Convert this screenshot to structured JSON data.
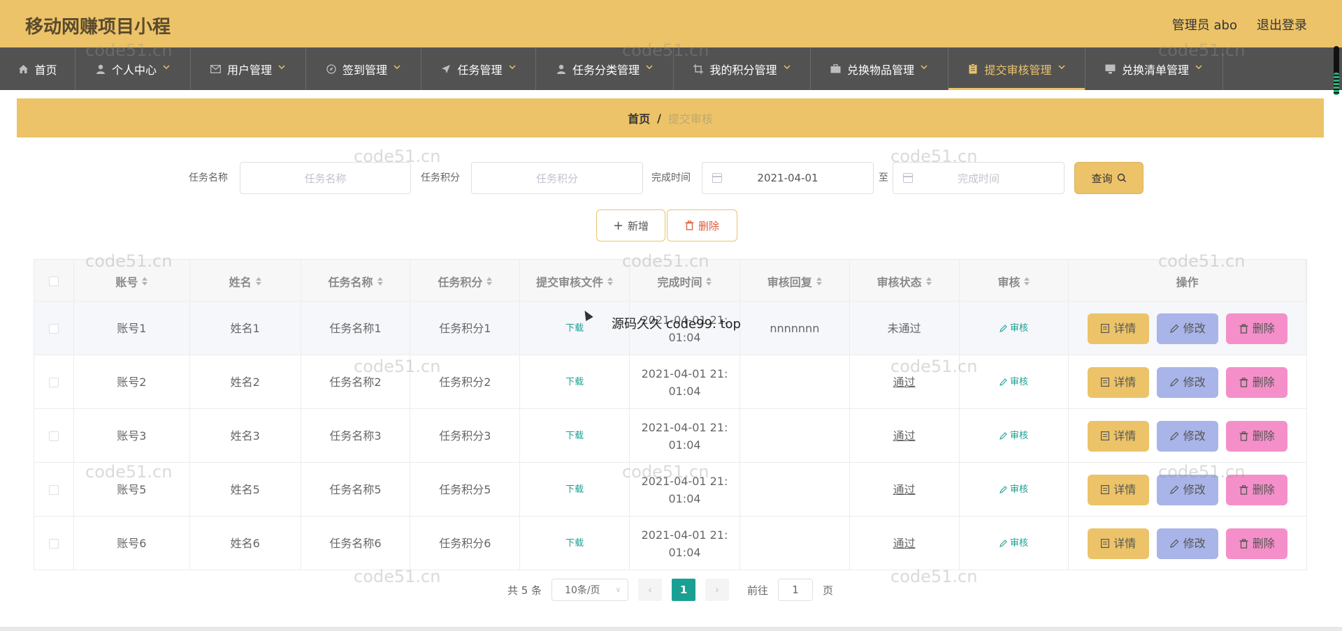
{
  "header": {
    "title": "移动网赚项目小程",
    "user": "管理员 abo",
    "logout": "退出登录"
  },
  "nav": [
    {
      "label": "首页",
      "icon": "home-icon",
      "width": 108
    },
    {
      "label": "个人中心",
      "icon": "user-icon",
      "width": 165
    },
    {
      "label": "用户管理",
      "icon": "mail-icon",
      "width": 165
    },
    {
      "label": "签到管理",
      "icon": "compass-icon",
      "width": 165
    },
    {
      "label": "任务管理",
      "icon": "send-icon",
      "width": 164
    },
    {
      "label": "任务分类管理",
      "icon": "user-icon",
      "width": 197
    },
    {
      "label": "我的积分管理",
      "icon": "crop-icon",
      "width": 196
    },
    {
      "label": "兑换物品管理",
      "icon": "briefcase-icon",
      "width": 197
    },
    {
      "label": "提交审核管理",
      "icon": "clipboard-icon",
      "width": 196,
      "active": true
    },
    {
      "label": "兑换清单管理",
      "icon": "monitor-icon",
      "width": 197
    }
  ],
  "breadcrumb": {
    "home": "首页",
    "separator": "/",
    "current": "提交审核"
  },
  "search": {
    "task_name_label": "任务名称",
    "task_name_placeholder": "任务名称",
    "task_points_label": "任务积分",
    "task_points_placeholder": "任务积分",
    "finish_time_label": "完成时间",
    "finish_time_start": "2021-04-01",
    "to_label": "至",
    "finish_time_end_placeholder": "完成时间",
    "query_label": "查询"
  },
  "actions": {
    "add_label": "新增",
    "delete_label": "删除"
  },
  "table": {
    "columns": [
      "账号",
      "姓名",
      "任务名称",
      "任务积分",
      "提交审核文件",
      "完成时间",
      "审核回复",
      "审核状态",
      "审核",
      "操作"
    ],
    "rows": [
      {
        "account": "账号1",
        "name": "姓名1",
        "task_name": "任务名称1",
        "task_points": "任务积分1",
        "file": "下载",
        "time": "2021-04-01 21:01:04",
        "reply": "nnnnnnn",
        "status": "未通过",
        "audit": "审核"
      },
      {
        "account": "账号2",
        "name": "姓名2",
        "task_name": "任务名称2",
        "task_points": "任务积分2",
        "file": "下载",
        "time": "2021-04-01 21:01:04",
        "reply": "",
        "status": "通过",
        "audit": "审核"
      },
      {
        "account": "账号3",
        "name": "姓名3",
        "task_name": "任务名称3",
        "task_points": "任务积分3",
        "file": "下载",
        "time": "2021-04-01 21:01:04",
        "reply": "",
        "status": "通过",
        "audit": "审核"
      },
      {
        "account": "账号5",
        "name": "姓名5",
        "task_name": "任务名称5",
        "task_points": "任务积分5",
        "file": "下载",
        "time": "2021-04-01 21:01:04",
        "reply": "",
        "status": "通过",
        "audit": "审核"
      },
      {
        "account": "账号6",
        "name": "姓名6",
        "task_name": "任务名称6",
        "task_points": "任务积分6",
        "file": "下载",
        "time": "2021-04-01 21:01:04",
        "reply": "",
        "status": "通过",
        "audit": "审核"
      }
    ],
    "ops": {
      "detail": "详情",
      "edit": "修改",
      "delete": "删除"
    }
  },
  "pagination": {
    "total": "共 5 条",
    "page_size": "10条/页",
    "current_page": "1",
    "goto_label": "前往",
    "goto_value": "1",
    "page_suffix": "页"
  },
  "watermark": "code51.cn",
  "overlay": "源码久久 code99. top"
}
